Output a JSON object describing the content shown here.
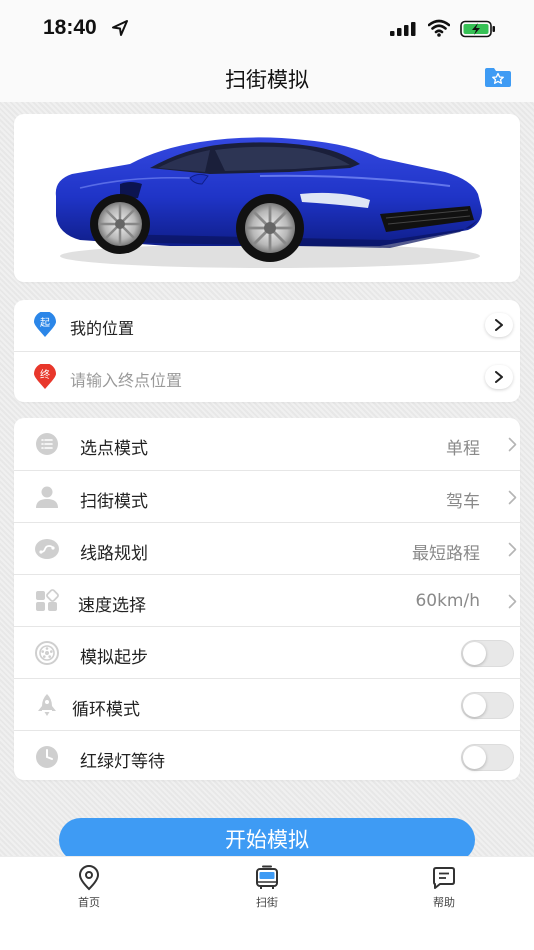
{
  "status_bar": {
    "time": "18:40"
  },
  "nav": {
    "title": "扫街模拟"
  },
  "locations": {
    "start": {
      "badge": "起",
      "label": "我的位置"
    },
    "end": {
      "badge": "终",
      "placeholder": "请输入终点位置"
    }
  },
  "settings": [
    {
      "label": "选点模式",
      "value": "单程",
      "type": "select",
      "icon": "list-icon"
    },
    {
      "label": "扫街模式",
      "value": "驾车",
      "type": "select",
      "icon": "person-icon"
    },
    {
      "label": "线路规划",
      "value": "最短路程",
      "type": "select",
      "icon": "route-icon"
    },
    {
      "label": "速度选择",
      "value": "60km/h",
      "type": "select",
      "icon": "grid-icon"
    },
    {
      "label": "模拟起步",
      "on": false,
      "type": "toggle",
      "icon": "wheel-icon"
    },
    {
      "label": "循环模式",
      "on": false,
      "type": "toggle",
      "icon": "rocket-icon"
    },
    {
      "label": "红绿灯等待",
      "on": false,
      "type": "toggle",
      "icon": "clock-icon"
    }
  ],
  "start_button": {
    "label": "开始模拟"
  },
  "tabs": [
    {
      "label": "首页",
      "icon": "location-pin-icon"
    },
    {
      "label": "扫街",
      "icon": "bus-icon"
    },
    {
      "label": "帮助",
      "icon": "chat-icon"
    }
  ],
  "colors": {
    "accent": "#3e9bf4",
    "start_pin": "#2b86e8",
    "end_pin": "#e8372b",
    "car": "#1f34c7"
  }
}
